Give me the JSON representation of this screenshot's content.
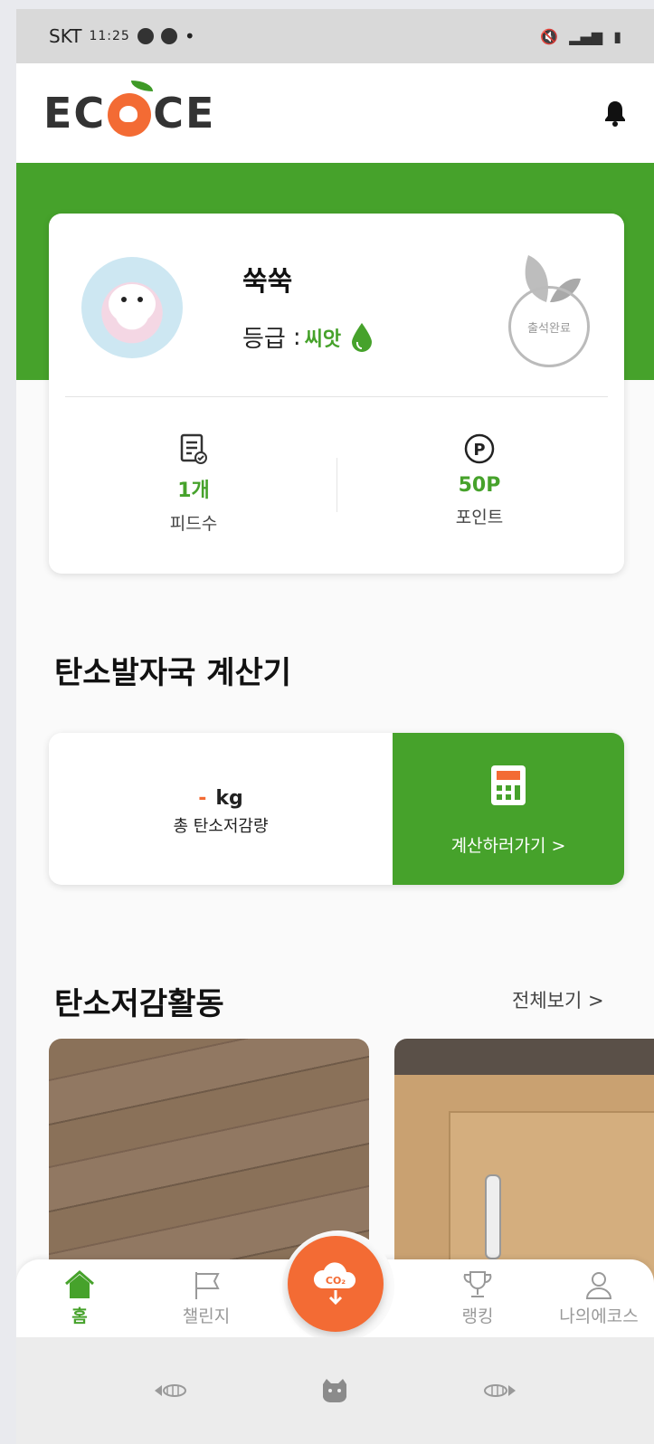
{
  "status_bar": {
    "carrier": "SKT",
    "time": "11:25",
    "dot": "•"
  },
  "app": {
    "logo": "ECOCE",
    "notification_icon": "bell-icon"
  },
  "profile": {
    "nickname": "쑥쑥",
    "grade_label": "등급",
    "grade_sep": ":",
    "grade_value": "씨앗",
    "attendance_badge": "출석완료",
    "stats": [
      {
        "icon": "feed-doc-icon",
        "value": "1개",
        "label": "피드수"
      },
      {
        "icon": "point-icon",
        "value": "50P",
        "label": "포인트"
      }
    ]
  },
  "calculator": {
    "title": "탄소발자국 계산기",
    "value_dash": "-",
    "value_unit": "kg",
    "value_label": "총 탄소저감량",
    "button_label": "계산하러가기 >"
  },
  "activities": {
    "title": "탄소저감활동",
    "view_all": "전체보기 >"
  },
  "bottom_nav": {
    "items": [
      {
        "label": "홈",
        "icon": "home-icon",
        "active": true
      },
      {
        "label": "챌린지",
        "icon": "flag-icon",
        "active": false
      },
      {
        "label": "랭킹",
        "icon": "trophy-icon",
        "active": false
      },
      {
        "label": "나의에코스",
        "icon": "person-icon",
        "active": false
      }
    ],
    "fab_text": "CO₂"
  },
  "colors": {
    "primary_green": "#46a22b",
    "accent_orange": "#f36b34"
  }
}
